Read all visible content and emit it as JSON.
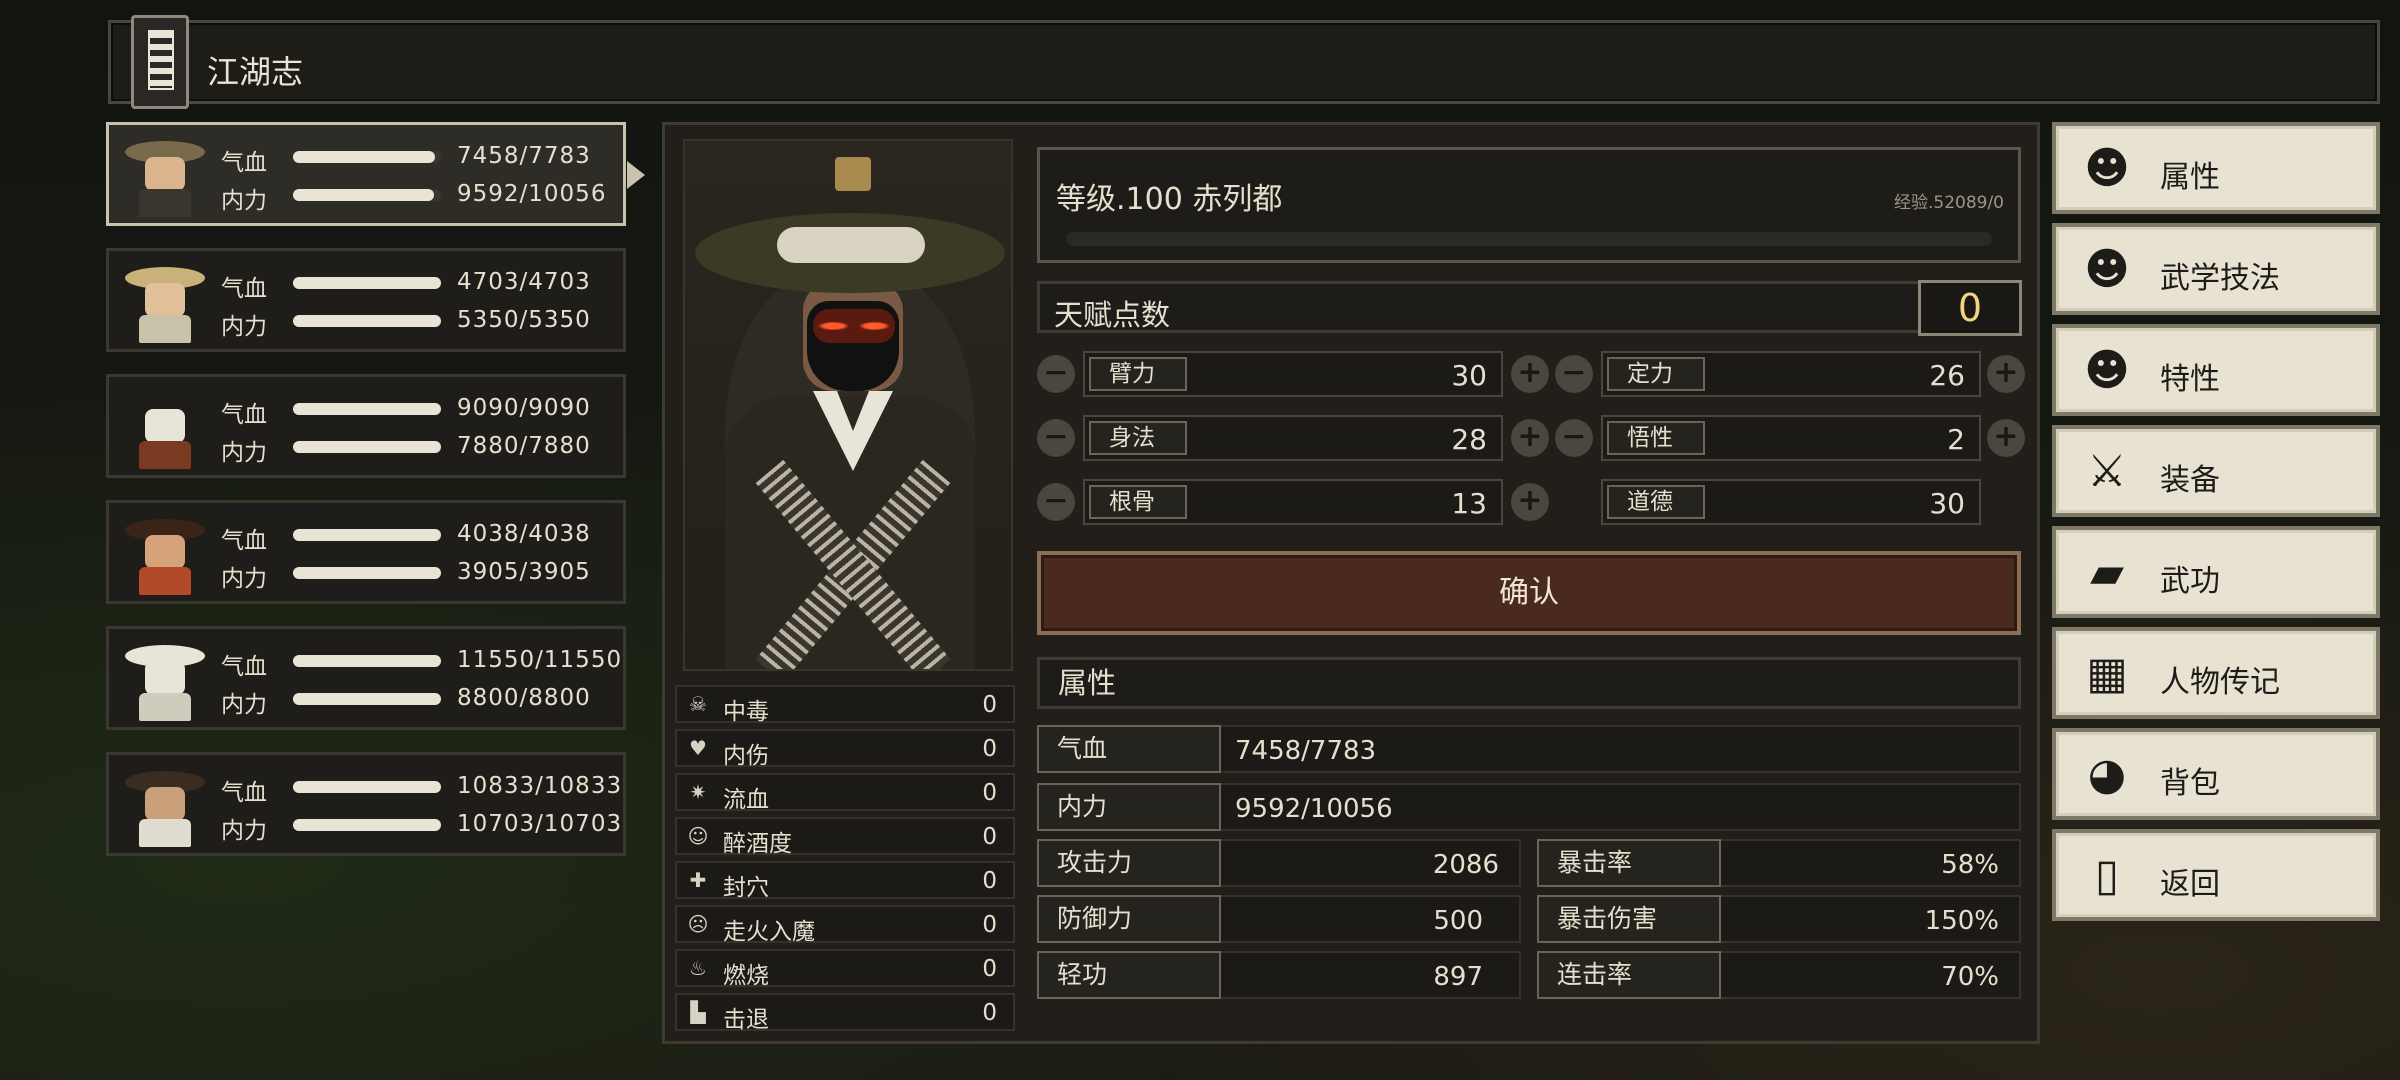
{
  "window": {
    "title": "江湖志"
  },
  "party": [
    {
      "hp_label": "气血",
      "hp": "7458/7783",
      "hp_frac": 0.958,
      "mp_label": "内力",
      "mp": "9592/10056",
      "mp_frac": 0.954,
      "selected": true
    },
    {
      "hp_label": "气血",
      "hp": "4703/4703",
      "hp_frac": 1,
      "mp_label": "内力",
      "mp": "5350/5350",
      "mp_frac": 1
    },
    {
      "hp_label": "气血",
      "hp": "9090/9090",
      "hp_frac": 1,
      "mp_label": "内力",
      "mp": "7880/7880",
      "mp_frac": 1
    },
    {
      "hp_label": "气血",
      "hp": "4038/4038",
      "hp_frac": 1,
      "mp_label": "内力",
      "mp": "3905/3905",
      "mp_frac": 1
    },
    {
      "hp_label": "气血",
      "hp": "11550/11550",
      "hp_frac": 1,
      "mp_label": "内力",
      "mp": "8800/8800",
      "mp_frac": 1
    },
    {
      "hp_label": "气血",
      "hp": "10833/10833",
      "hp_frac": 1,
      "mp_label": "内力",
      "mp": "10703/10703",
      "mp_frac": 1
    }
  ],
  "character": {
    "level_name": "等级.100 赤列都",
    "exp": "经验.52089/0",
    "talent_label": "天赋点数",
    "talent_points": "0",
    "attributes": {
      "bili": {
        "label": "臂力",
        "value": "30"
      },
      "dingli": {
        "label": "定力",
        "value": "26"
      },
      "shenfa": {
        "label": "身法",
        "value": "28"
      },
      "wuxing": {
        "label": "悟性",
        "value": "2"
      },
      "gengu": {
        "label": "根骨",
        "value": "13"
      },
      "daode": {
        "label": "道德",
        "value": "30"
      }
    },
    "confirm_label": "确认",
    "props_header": "属性",
    "props": {
      "hp": {
        "label": "气血",
        "value": "7458/7783"
      },
      "mp": {
        "label": "内力",
        "value": "9592/10056"
      },
      "atk": {
        "label": "攻击力",
        "value": "2086"
      },
      "crit": {
        "label": "暴击率",
        "value": "58%"
      },
      "def": {
        "label": "防御力",
        "value": "500"
      },
      "critdmg": {
        "label": "暴击伤害",
        "value": "150%"
      },
      "qinggong": {
        "label": "轻功",
        "value": "897"
      },
      "combo": {
        "label": "连击率",
        "value": "70%"
      }
    }
  },
  "statuses": [
    {
      "icon": "skull-icon",
      "glyph": "☠",
      "label": "中毒",
      "value": "0"
    },
    {
      "icon": "broken-heart-icon",
      "glyph": "♥",
      "label": "内伤",
      "value": "0"
    },
    {
      "icon": "blood-drop-icon",
      "glyph": "✷",
      "label": "流血",
      "value": "0"
    },
    {
      "icon": "drunk-face-icon",
      "glyph": "☺",
      "label": "醉酒度",
      "value": "0"
    },
    {
      "icon": "seal-points-icon",
      "glyph": "✚",
      "label": "封穴",
      "value": "0"
    },
    {
      "icon": "demon-face-icon",
      "glyph": "☹",
      "label": "走火入魔",
      "value": "0"
    },
    {
      "icon": "flame-icon",
      "glyph": "♨",
      "label": "燃烧",
      "value": "0"
    },
    {
      "icon": "boot-icon",
      "glyph": "▙",
      "label": "击退",
      "value": "0"
    }
  ],
  "menu": [
    {
      "icon": "character-icon",
      "glyph": "☻",
      "label": "属性"
    },
    {
      "icon": "martial-skill-icon",
      "glyph": "☻",
      "label": "武学技法"
    },
    {
      "icon": "trait-icon",
      "glyph": "☻",
      "label": "特性"
    },
    {
      "icon": "sword-icon",
      "glyph": "⚔",
      "label": "装备"
    },
    {
      "icon": "martial-book-icon",
      "glyph": "▰",
      "label": "武功"
    },
    {
      "icon": "biography-scroll-icon",
      "glyph": "▦",
      "label": "人物传记"
    },
    {
      "icon": "backpack-icon",
      "glyph": "◕",
      "label": "背包"
    },
    {
      "icon": "door-icon",
      "glyph": "▯",
      "label": "返回"
    }
  ],
  "colors": {
    "accent": "#f2d584",
    "confirm": "#4a2a1d",
    "menu_bg": "#e7e2d1"
  }
}
